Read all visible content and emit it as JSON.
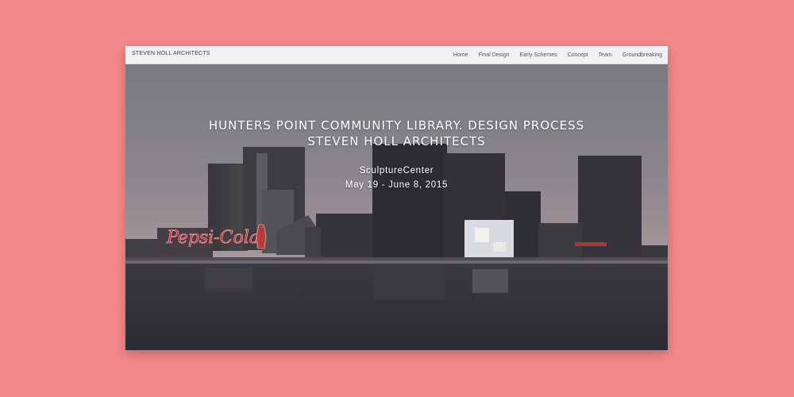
{
  "brand": "STEVEN HOLL ARCHITECTS",
  "nav": {
    "items": [
      {
        "label": "Home"
      },
      {
        "label": "Final Design"
      },
      {
        "label": "Early Schemes"
      },
      {
        "label": "Concept"
      },
      {
        "label": "Team"
      },
      {
        "label": "Groundbreaking"
      }
    ]
  },
  "hero": {
    "title_line1": "HUNTERS POINT COMMUNITY LIBRARY. DESIGN PROCESS",
    "title_line2": "STEVEN HOLL ARCHITECTS",
    "venue": "SculptureCenter",
    "dates": "May 19 - June 8, 2015",
    "sign_text": "Pepsi-Cola"
  },
  "colors": {
    "page_background": "#f4898b",
    "navbar_background": "#f1f1f3",
    "sign_red": "#d4272e"
  }
}
